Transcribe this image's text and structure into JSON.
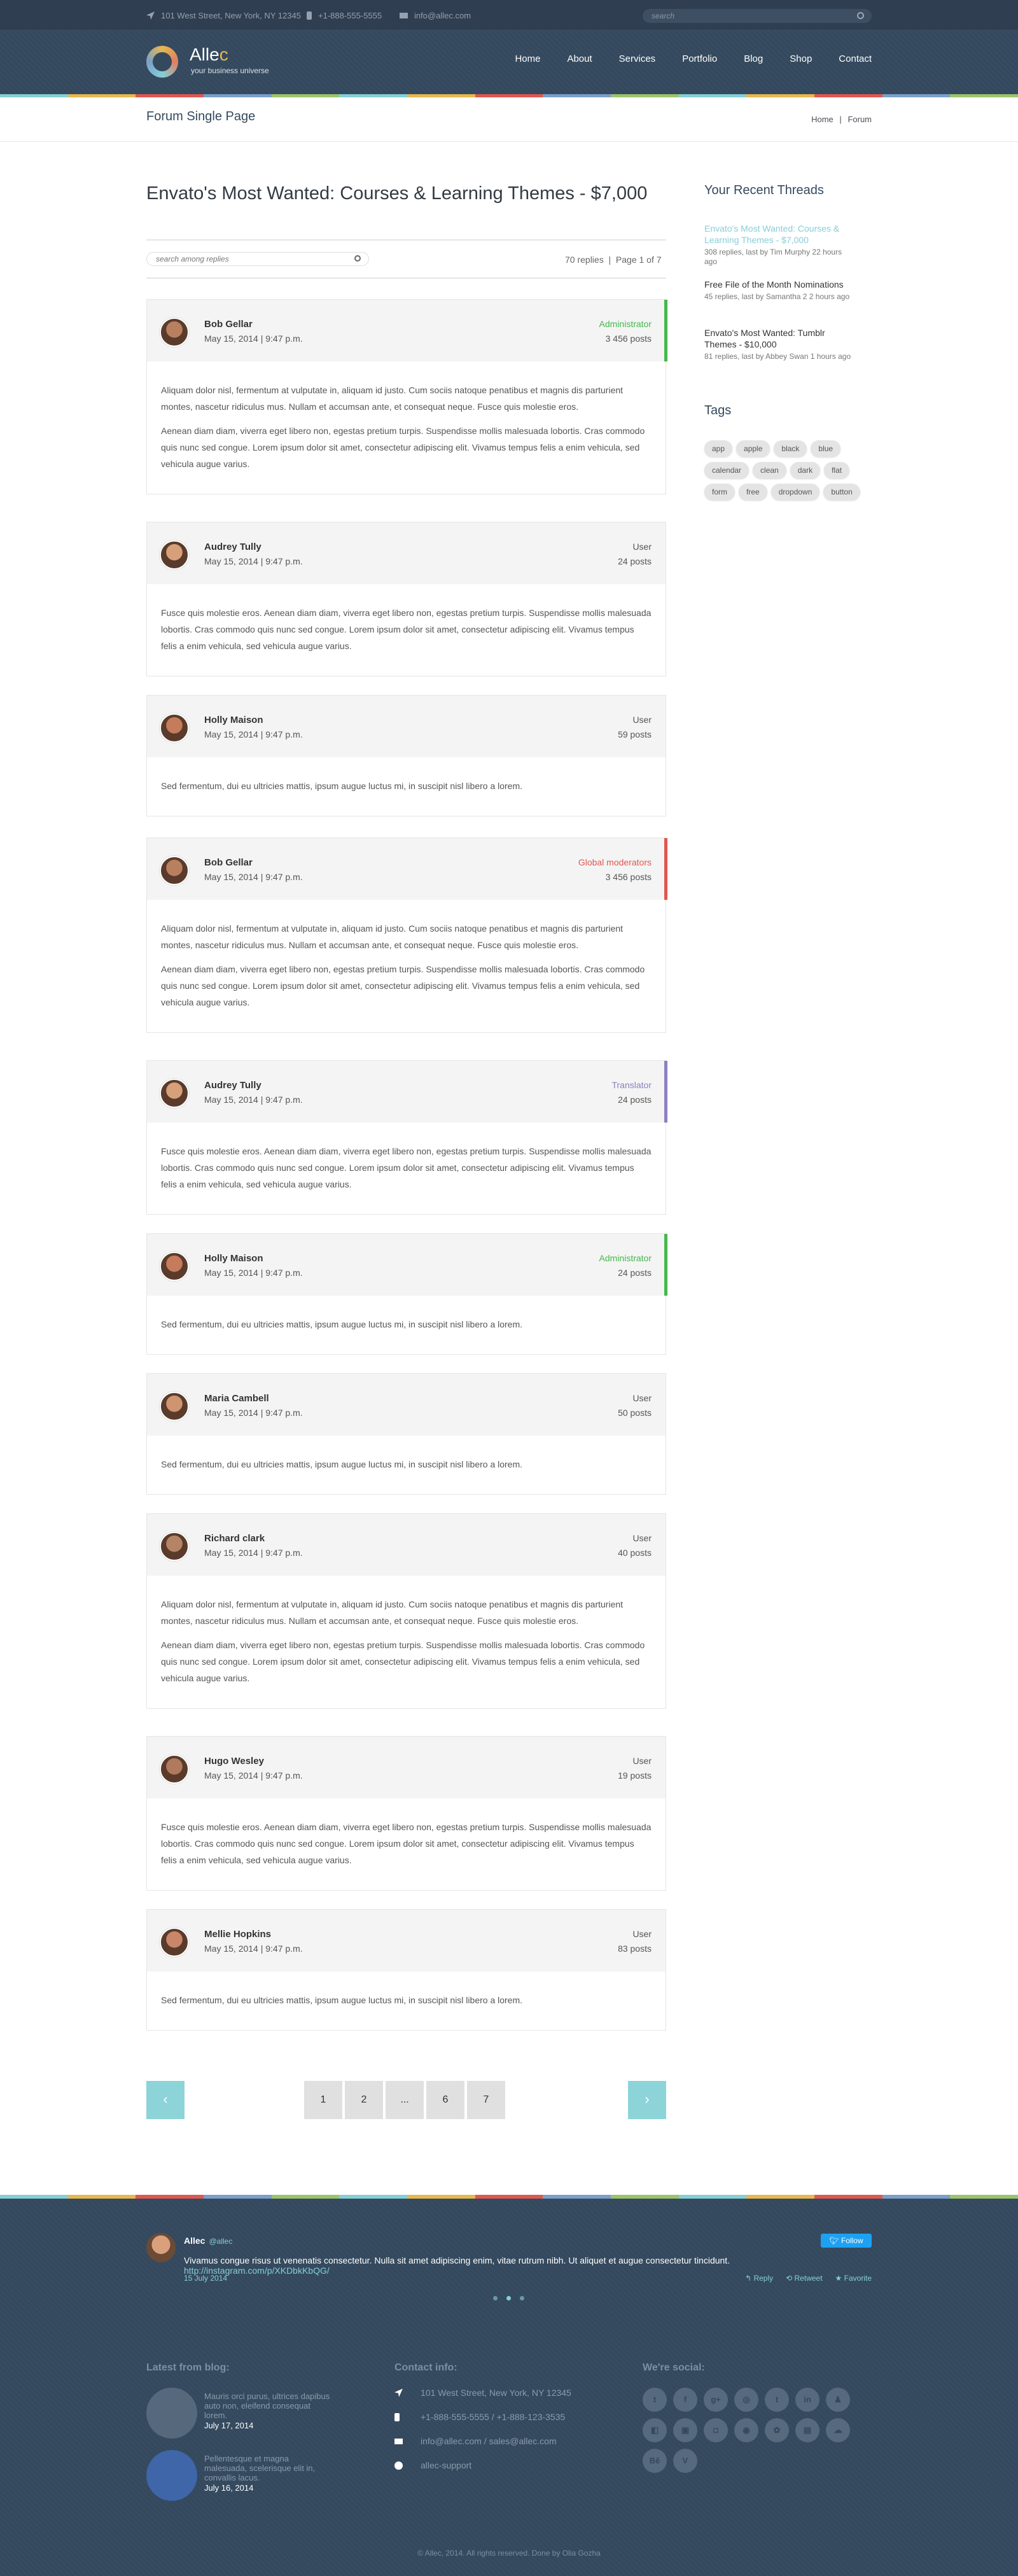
{
  "topbar": {
    "address": "101 West Street, New York, NY 12345",
    "phone": "+1-888-555-5555",
    "email": "info@allec.com",
    "search_placeholder": "search"
  },
  "logo": {
    "name_a": "Alle",
    "name_b": "c",
    "tagline": "your business universe"
  },
  "nav": [
    "Home",
    "About",
    "Services",
    "Portfolio",
    "Blog",
    "Shop",
    "Contact"
  ],
  "page": {
    "title": "Forum Single Page",
    "crumbs": [
      "Home",
      "|",
      "Forum"
    ]
  },
  "thread": {
    "title": "Envato's Most Wanted: Courses & Learning Themes - $7,000",
    "search_placeholder": "search among replies",
    "replies": "70 replies",
    "sep": "|",
    "page": "Page 1 of 7"
  },
  "colors": {
    "accent": "#85cfd6",
    "admin": "#45b84c",
    "moderator": "#e0574f",
    "translator": "#8d7fbf",
    "stripe": [
      "#85cfd6",
      "#e6b84e",
      "#e0574f",
      "#7a9fc9",
      "#9bc46b"
    ]
  },
  "posts": [
    {
      "name": "Bob Gellar",
      "date": "May 15, 2014 | 9:47 p.m.",
      "role": "Administrator",
      "posts": "3 456 posts",
      "body": [
        "Aliquam dolor nisl, fermentum at vulputate in, aliquam id justo. Cum sociis natoque penatibus et magnis dis parturient montes, nascetur ridiculus mus. Nullam et accumsan ante, et consequat neque. Fusce quis molestie eros.",
        "Aenean diam diam, viverra eget libero non, egestas pretium turpis. Suspendisse mollis malesuada lobortis. Cras commodo quis nunc sed congue. Lorem ipsum dolor sit amet, consectetur adipiscing elit. Vivamus tempus felis a enim vehicula, sed vehicula augue varius."
      ]
    },
    {
      "name": "Audrey Tully",
      "date": "May 15, 2014 | 9:47 p.m.",
      "role": "User",
      "posts": "24 posts",
      "body": [
        "Fusce quis molestie eros. Aenean diam diam, viverra eget libero non, egestas pretium turpis. Suspendisse mollis malesuada lobortis. Cras commodo quis nunc sed congue. Lorem ipsum dolor sit amet, consectetur adipiscing elit. Vivamus tempus felis a enim vehicula, sed vehicula augue varius."
      ]
    },
    {
      "name": "Holly Maison",
      "date": "May 15, 2014 | 9:47 p.m.",
      "role": "User",
      "posts": "59 posts",
      "body": [
        "Sed fermentum, dui eu ultricies mattis, ipsum augue luctus mi, in suscipit nisl libero a lorem."
      ]
    },
    {
      "name": "Bob Gellar",
      "date": "May 15, 2014 | 9:47 p.m.",
      "role": "Global moderators",
      "posts": "3 456 posts",
      "body": [
        "Aliquam dolor nisl, fermentum at vulputate in, aliquam id justo. Cum sociis natoque penatibus et magnis dis parturient montes, nascetur ridiculus mus. Nullam et accumsan ante, et consequat neque. Fusce quis molestie eros.",
        "Aenean diam diam, viverra eget libero non, egestas pretium turpis. Suspendisse mollis malesuada lobortis. Cras commodo quis nunc sed congue. Lorem ipsum dolor sit amet, consectetur adipiscing elit. Vivamus tempus felis a enim vehicula, sed vehicula augue varius."
      ]
    },
    {
      "name": "Audrey Tully",
      "date": "May 15, 2014 | 9:47 p.m.",
      "role": "Translator",
      "posts": "24 posts",
      "body": [
        "Fusce quis molestie eros. Aenean diam diam, viverra eget libero non, egestas pretium turpis. Suspendisse mollis malesuada lobortis. Cras commodo quis nunc sed congue. Lorem ipsum dolor sit amet, consectetur adipiscing elit. Vivamus tempus felis a enim vehicula, sed vehicula augue varius."
      ]
    },
    {
      "name": "Holly Maison",
      "date": "May 15, 2014 | 9:47 p.m.",
      "role": "Administrator",
      "posts": "24 posts",
      "body": [
        "Sed fermentum, dui eu ultricies mattis, ipsum augue luctus mi, in suscipit nisl libero a lorem."
      ]
    },
    {
      "name": "Maria Cambell",
      "date": "May 15, 2014 | 9:47 p.m.",
      "role": "User",
      "posts": "50 posts",
      "body": [
        "Sed fermentum, dui eu ultricies mattis, ipsum augue luctus mi, in suscipit nisl libero a lorem."
      ]
    },
    {
      "name": "Richard clark",
      "date": "May 15, 2014 | 9:47 p.m.",
      "role": "User",
      "posts": "40 posts",
      "body": [
        "Aliquam dolor nisl, fermentum at vulputate in, aliquam id justo. Cum sociis natoque penatibus et magnis dis parturient montes, nascetur ridiculus mus. Nullam et accumsan ante, et consequat neque. Fusce quis molestie eros.",
        "Aenean diam diam, viverra eget libero non, egestas pretium turpis. Suspendisse mollis malesuada lobortis. Cras commodo quis nunc sed congue. Lorem ipsum dolor sit amet, consectetur adipiscing elit. Vivamus tempus felis a enim vehicula, sed vehicula augue varius."
      ]
    },
    {
      "name": "Hugo Wesley",
      "date": "May 15, 2014 | 9:47 p.m.",
      "role": "User",
      "posts": "19 posts",
      "body": [
        "Fusce quis molestie eros. Aenean diam diam, viverra eget libero non, egestas pretium turpis. Suspendisse mollis malesuada lobortis. Cras commodo quis nunc sed congue. Lorem ipsum dolor sit amet, consectetur adipiscing elit. Vivamus tempus felis a enim vehicula, sed vehicula augue varius."
      ]
    },
    {
      "name": "Mellie Hopkins",
      "date": "May 15, 2014 | 9:47 p.m.",
      "role": "User",
      "posts": "83 posts",
      "body": [
        "Sed fermentum, dui eu ultricies mattis, ipsum augue luctus mi, in suscipit nisl libero a lorem."
      ]
    }
  ],
  "pagination": {
    "prev": "‹",
    "next": "›",
    "pages": [
      "1",
      "2",
      "...",
      "6",
      "7"
    ]
  },
  "sidebar": {
    "recent_title": "Your Recent Threads",
    "threads": [
      {
        "title": "Envato's Most Wanted: Courses & Learning Themes - $7,000",
        "meta": "308 replies, last by Tim Murphy 22 hours ago",
        "active": true
      },
      {
        "title": "Free File of the Month Nominations",
        "meta": "45 replies, last by Samantha 2 2 hours ago",
        "active": false
      },
      {
        "title": " Envato's Most Wanted: Tumblr Themes - $10,000",
        "meta": "81 replies, last by Abbey Swan 1 hours ago",
        "active": false
      }
    ],
    "tags_title": "Tags",
    "tags": [
      "app",
      "apple",
      "black",
      "blue",
      "calendar",
      "clean",
      "dark",
      "flat",
      "form",
      "free",
      "dropdown",
      "button"
    ]
  },
  "tweet": {
    "name": "Allec",
    "handle": "@allec",
    "follow": "Follow",
    "text": "Vivamus congue risus ut venenatis consectetur. Nulla sit amet adipiscing enim, vitae rutrum nibh. Ut aliquet et augue consectetur tincidunt.",
    "link": "http://instagram.com/p/XKDbkKbQG/",
    "date": "15 July 2014",
    "reply": "Reply",
    "retweet": "Retweet",
    "favorite": "Favorite"
  },
  "footer": {
    "blog_title": "Latest from blog:",
    "blog": [
      {
        "text": "Mauris orci purus, ultrices dapibus auto non, eleifend consequat lorem.",
        "date": "July 17, 2014"
      },
      {
        "text": "Pellentesque et magna malesuada, scelerisque elit in, convallis lacus.",
        "date": "July 16, 2014"
      }
    ],
    "contact_title": "Contact info:",
    "contact": [
      "101 West Street, New York, NY 12345",
      "+1-888-555-5555 / +1-888-123-3535",
      "info@allec.com / sales@allec.com",
      "allec-support"
    ],
    "social_title": "We're social:",
    "social": [
      "t",
      "f",
      "g+",
      "◎",
      "t",
      "in",
      "♟",
      "◧",
      "▣",
      "◘",
      "◉",
      "✿",
      "▤",
      "☁",
      "Bē",
      "V"
    ],
    "copyright": "© Allec, 2014. All rights reserved. Done by Olia Gozha"
  }
}
